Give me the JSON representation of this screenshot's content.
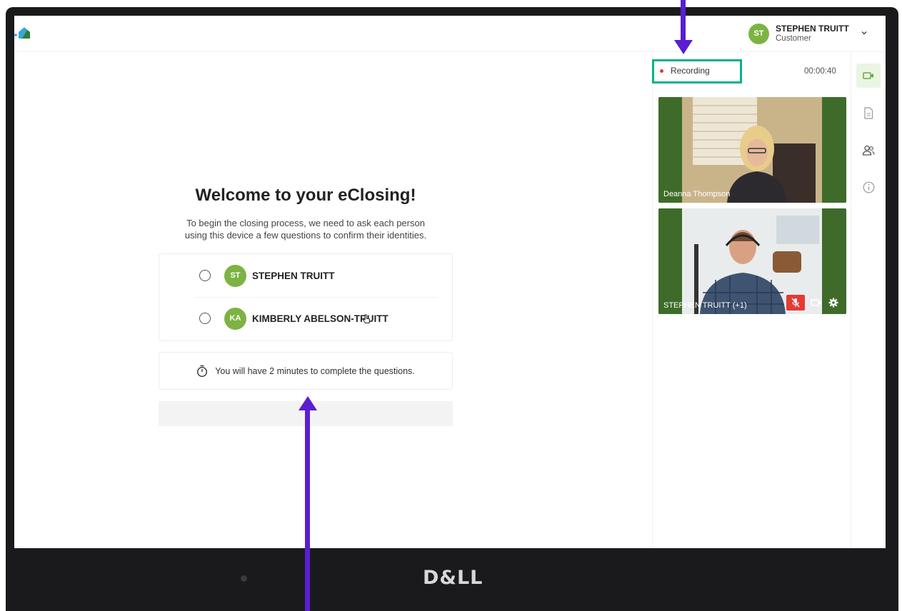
{
  "header": {
    "user_initials": "ST",
    "user_name": "STEPHEN TRUITT",
    "user_role": "Customer"
  },
  "main": {
    "title": "Welcome to your eClosing!",
    "subtitle_line1": "To begin the closing process, we need to ask each person",
    "subtitle_line2": "using this device a few questions to confirm their identities.",
    "people": [
      {
        "initials": "ST",
        "name": "STEPHEN TRUITT"
      },
      {
        "initials": "KA",
        "name": "KIMBERLY ABELSON-TRUITT"
      }
    ],
    "timer_text": "You will have 2 minutes to complete the questions."
  },
  "session": {
    "recording_label": "Recording",
    "elapsed": "00:00:40"
  },
  "videos": [
    {
      "label": "Deanna Thompson"
    },
    {
      "label": "STEPHEN TRUITT (+1)"
    }
  ],
  "rail": [
    "video-icon",
    "document-icon",
    "participants-icon",
    "info-icon"
  ],
  "device": {
    "brand": "D&LL"
  },
  "colors": {
    "accent_green": "#7cb342",
    "recording_border": "#00b388",
    "annotation_arrow": "#5a1ed0",
    "mute_red": "#e53935"
  }
}
